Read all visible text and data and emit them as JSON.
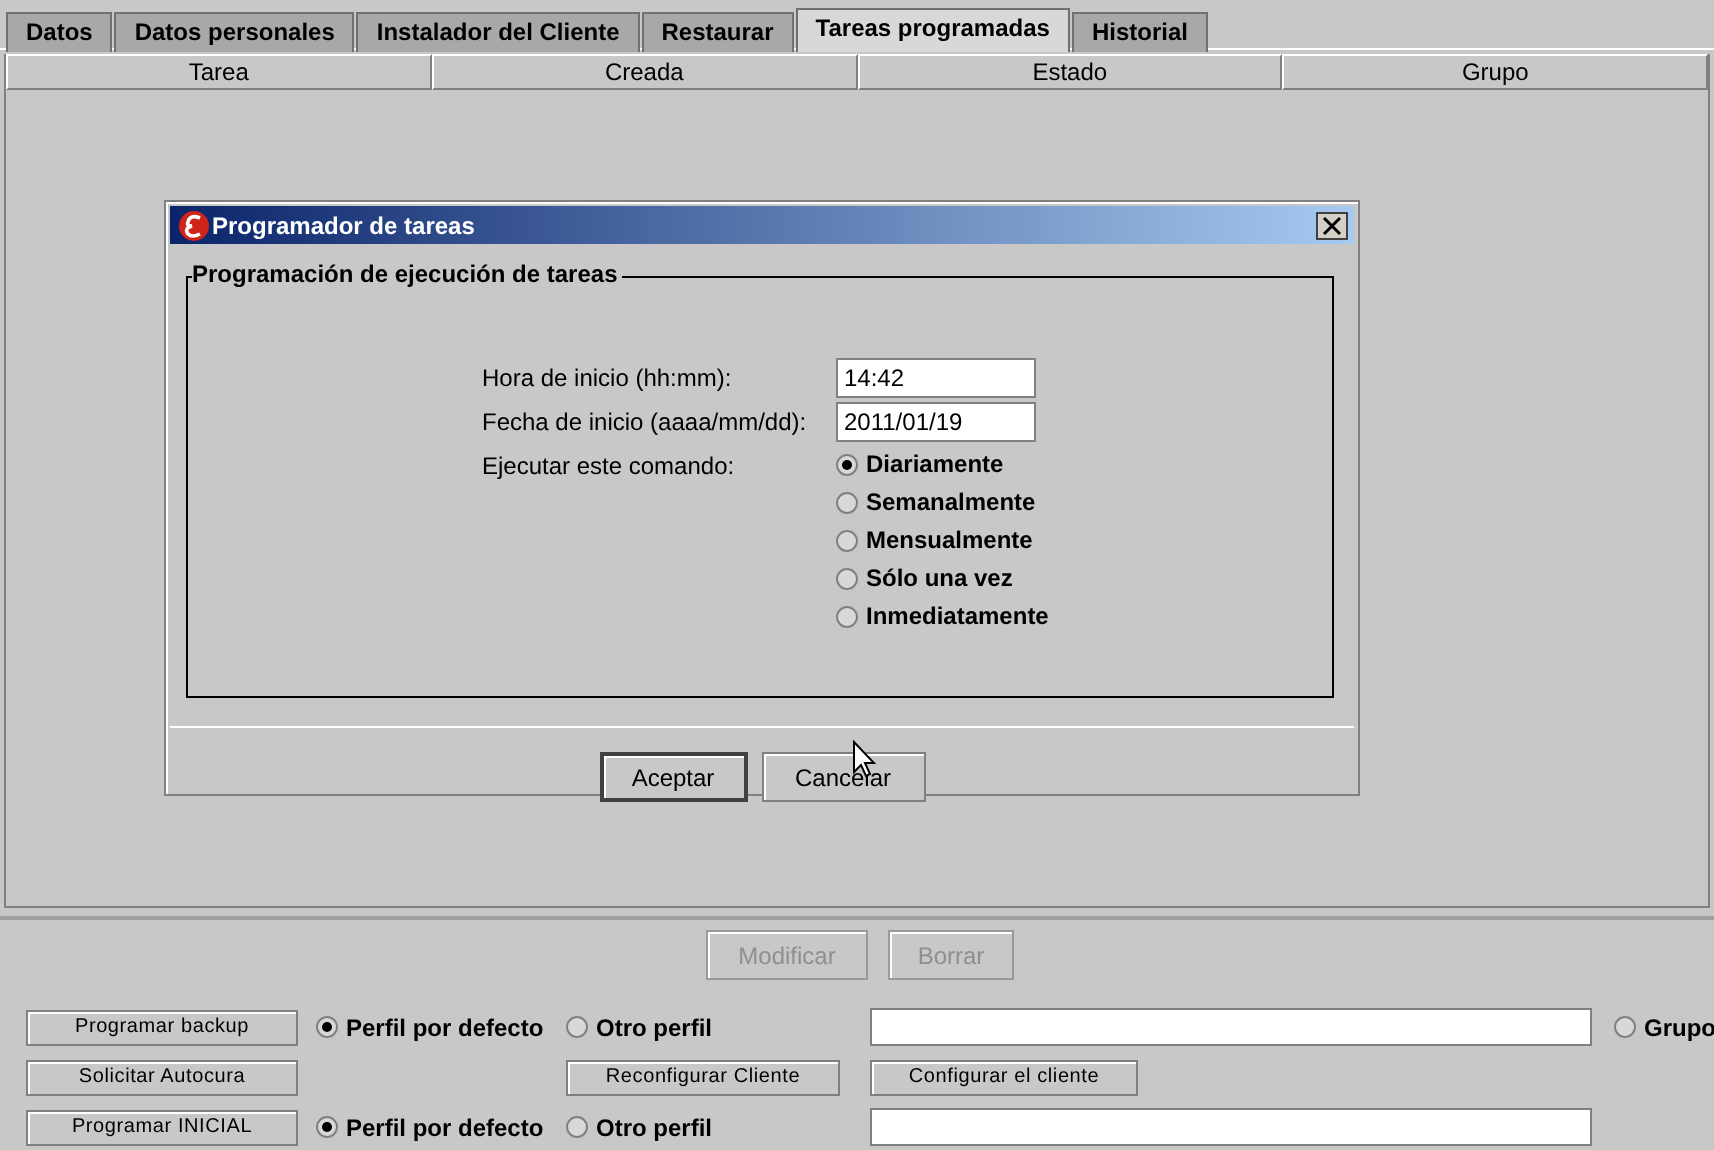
{
  "tabs": [
    {
      "label": "Datos",
      "selected": false
    },
    {
      "label": "Datos personales",
      "selected": false
    },
    {
      "label": "Instalador del Cliente",
      "selected": false
    },
    {
      "label": "Restaurar",
      "selected": false
    },
    {
      "label": "Tareas programadas",
      "selected": true
    },
    {
      "label": "Historial",
      "selected": false
    }
  ],
  "table": {
    "columns": [
      "Tarea",
      "Creada",
      "Estado",
      "Grupo"
    ]
  },
  "dialog": {
    "title": "Programador de tareas",
    "group_title": "Programación de ejecución de tareas",
    "fields": [
      {
        "label": "Hora de inicio (hh:mm):",
        "value": "14:42"
      },
      {
        "label": "Fecha de inicio (aaaa/mm/dd):",
        "value": "2011/01/19"
      }
    ],
    "run_label": "Ejecutar este comando:",
    "options": [
      {
        "label": "Diariamente",
        "selected": true
      },
      {
        "label": "Semanalmente",
        "selected": false
      },
      {
        "label": "Mensualmente",
        "selected": false
      },
      {
        "label": "Sólo una vez",
        "selected": false
      },
      {
        "label": "Inmediatamente",
        "selected": false
      }
    ],
    "buttons": [
      "Aceptar",
      "Cancelar"
    ]
  },
  "actions": [
    {
      "label": "Modificar",
      "disabled": true
    },
    {
      "label": "Borrar",
      "disabled": true
    }
  ],
  "rows": [
    {
      "kind": "profile",
      "button": "Programar backup",
      "radios": [
        {
          "label": "Perfil por defecto",
          "selected": true
        },
        {
          "label": "Otro perfil",
          "selected": false
        }
      ],
      "extra_radio": {
        "label": "Grupo",
        "selected": false
      }
    },
    {
      "kind": "buttons",
      "button": "Solicitar Autocura",
      "buttons": [
        "Reconfigurar Cliente",
        "Configurar el cliente"
      ]
    },
    {
      "kind": "profile",
      "button": "Programar INICIAL",
      "radios": [
        {
          "label": "Perfil por defecto",
          "selected": true
        },
        {
          "label": "Otro perfil",
          "selected": false
        }
      ]
    }
  ]
}
